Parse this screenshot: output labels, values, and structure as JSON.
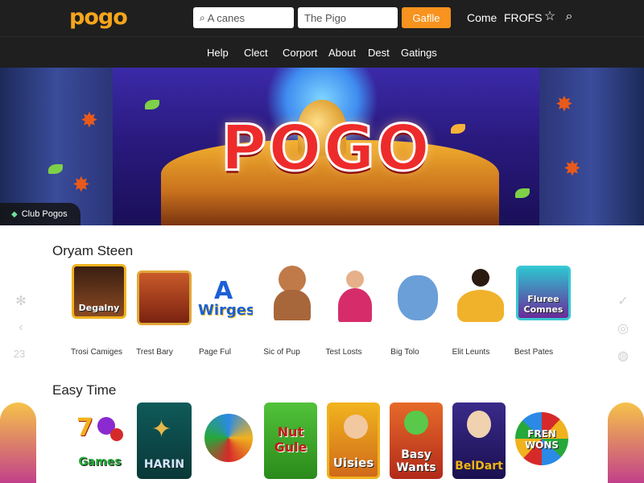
{
  "header": {
    "logo": "pogo",
    "search_placeholder": "A canes",
    "search2_placeholder": "The Pigo",
    "cta_label": "Gaflle",
    "links": [
      "Come",
      "FROFS"
    ],
    "icons": [
      "star-icon",
      "search-icon"
    ]
  },
  "nav": {
    "items": [
      "Help",
      "Clect",
      "Corport",
      "About",
      "Dest",
      "Gatings"
    ]
  },
  "hero": {
    "title": "POGO",
    "badge": "Club Pogos"
  },
  "sections": [
    {
      "title": "Oryam Steen",
      "games": [
        {
          "label": "Degalny",
          "caption": "Trosi Camiges"
        },
        {
          "label": "",
          "caption": "Trest Bary"
        },
        {
          "label": "Wirges",
          "caption": "Page Ful"
        },
        {
          "label": "",
          "caption": "Sic of Pup"
        },
        {
          "label": "",
          "caption": "Test Losts"
        },
        {
          "label": "",
          "caption": "Big Tolo"
        },
        {
          "label": "",
          "caption": "Elit Leunts"
        },
        {
          "label": "Fluree Comnes",
          "caption": "Best Pates"
        }
      ]
    },
    {
      "title": "Easy Time",
      "games": [
        {
          "label": "Games"
        },
        {
          "label": "HARIN"
        },
        {
          "label": ""
        },
        {
          "label": "Nut Gule"
        },
        {
          "label": "Uisies"
        },
        {
          "label": "Basy Wants"
        },
        {
          "label": "BelDart"
        },
        {
          "label": "FREN WONS"
        }
      ]
    }
  ],
  "side": {
    "left_number": "23"
  },
  "colors": {
    "brand_orange": "#f5a51c",
    "cta_orange": "#f7931e",
    "header_bg": "#1f1f1f",
    "hero_title_red": "#ee2b2b"
  }
}
